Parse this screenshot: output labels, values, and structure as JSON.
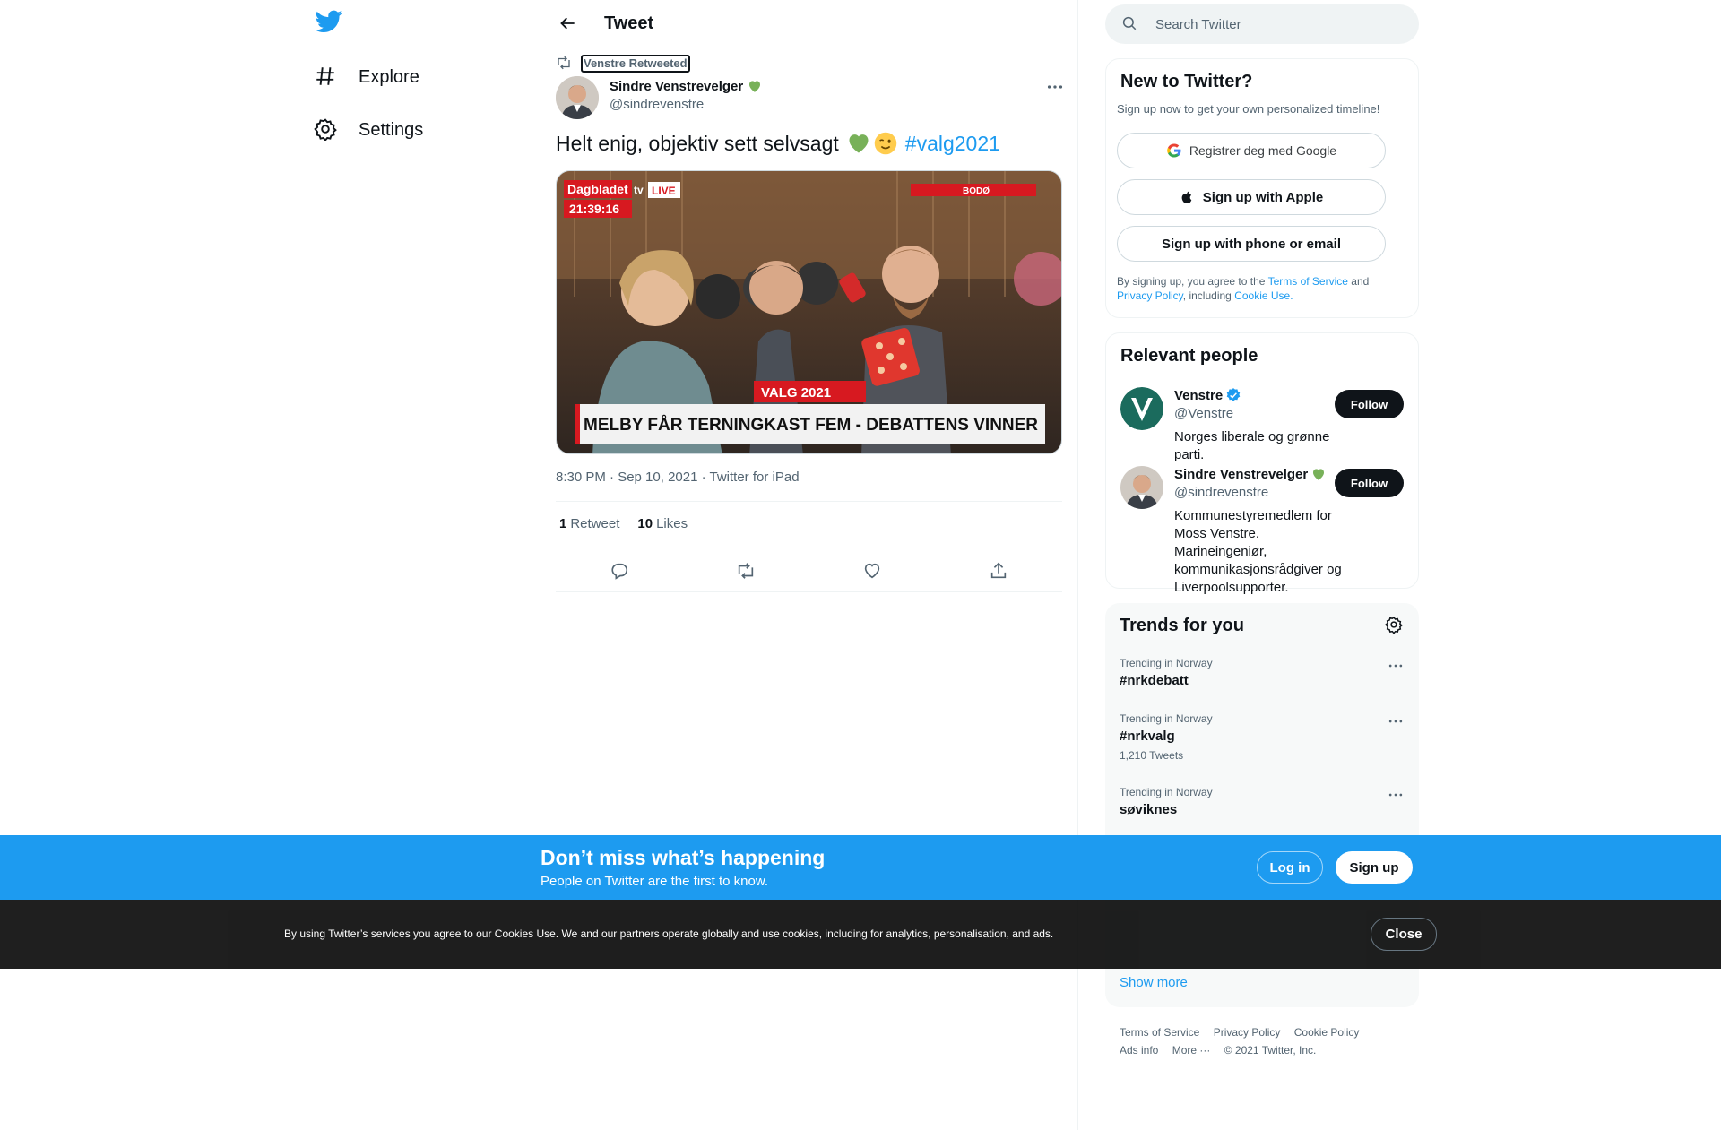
{
  "nav": {
    "explore_label": "Explore",
    "settings_label": "Settings"
  },
  "header": {
    "title": "Tweet"
  },
  "tweet": {
    "social_context": "Venstre Retweeted",
    "author_name": "Sindre Venstrevelger",
    "author_handle": "@sindrevenstre",
    "text": "Helt enig, objektiv sett selvsagt",
    "hashtag": "#valg2021",
    "timestamp": "8:30 PM · Sep 10, 2021 · Twitter for iPad",
    "retweet_count": "1",
    "retweet_label": "Retweet",
    "like_count": "10",
    "like_label": "Likes",
    "media": {
      "brand": "Dagbladet",
      "tv": "tv",
      "live": "LIVE",
      "clock": "21:39:16",
      "location": "BODØ",
      "election_tag": "VALG 2021",
      "caption": "MELBY FÅR TERNINGKAST FEM - DEBATTENS VINNER"
    }
  },
  "search": {
    "placeholder": "Search Twitter"
  },
  "signup_card": {
    "title": "New to Twitter?",
    "subtitle": "Sign up now to get your own personalized timeline!",
    "google_label": "Registrer deg med Google",
    "apple_label": "Sign up with Apple",
    "phone_label": "Sign up with phone or email",
    "legal_prefix": "By signing up, you agree to the",
    "terms_link": "Terms of Service",
    "and_text": "and",
    "privacy_link": "Privacy Policy",
    "including_text": ", including",
    "cookie_link": "Cookie Use."
  },
  "relevant_people": {
    "title": "Relevant people",
    "people": [
      {
        "name": "Venstre",
        "handle": "@Venstre",
        "bio": "Norges liberale og grønne parti.",
        "follow_label": "Follow"
      },
      {
        "name": "Sindre Venstrevelger",
        "handle": "@sindrevenstre",
        "bio": "Kommunestyremedlem for Moss Venstre. Marineingeniør, kommunikasjonsrådgiver og Liverpoolsupporter.",
        "follow_label": "Follow"
      }
    ]
  },
  "trends": {
    "title": "Trends for you",
    "items": [
      {
        "context": "Trending in Norway",
        "name": "#nrkdebatt",
        "count": ""
      },
      {
        "context": "Trending in Norway",
        "name": "#nrkvalg",
        "count": "1,210 Tweets"
      },
      {
        "context": "Trending in Norway",
        "name": "søviknes",
        "count": ""
      }
    ],
    "show_more": "Show more"
  },
  "footer": {
    "terms": "Terms of Service",
    "privacy": "Privacy Policy",
    "cookie": "Cookie Policy",
    "ads": "Ads info",
    "more": "More ···",
    "copyright": "© 2021 Twitter, Inc."
  },
  "banner": {
    "title": "Don’t miss what’s happening",
    "subtitle": "People on Twitter are the first to know.",
    "login_label": "Log in",
    "signup_label": "Sign up"
  },
  "cookie_bar": {
    "text": "By using Twitter’s services you agree to our Cookies Use. We and our partners operate globally and use cookies, including for analytics, personalisation, and ads.",
    "close_label": "Close"
  },
  "colors": {
    "accent": "#1d9bf0",
    "text_primary": "#0f1419",
    "text_secondary": "#536471",
    "green_heart": "#78b159"
  },
  "icons": [
    "twitter-logo-icon",
    "hashtag-icon",
    "gear-icon",
    "back-arrow-icon",
    "retweet-icon",
    "green-heart-icon",
    "more-icon",
    "winking-face-icon",
    "reply-icon",
    "like-icon",
    "share-icon",
    "search-icon",
    "google-icon",
    "apple-icon",
    "verified-badge-icon"
  ]
}
